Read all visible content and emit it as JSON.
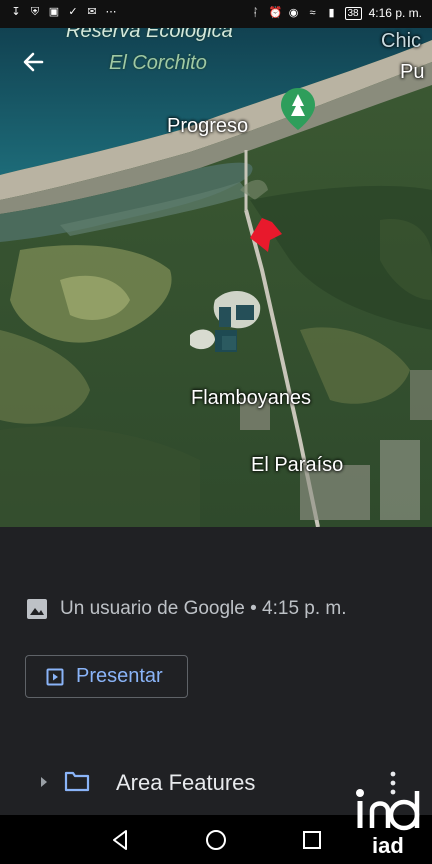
{
  "status_bar": {
    "battery": "38",
    "time": "4:16 p. m.",
    "left_icons": [
      "download-icon",
      "shield-icon",
      "image-icon",
      "check-icon",
      "mail-icon",
      "more-dots-icon"
    ],
    "right_icons": [
      "bluetooth-icon",
      "alarm-icon",
      "eye-icon",
      "wifi-icon",
      "signal-icon"
    ]
  },
  "map": {
    "labels": {
      "reserva_line1": "Reserva Ecológica",
      "reserva_line2": "El Corchito",
      "chic": "Chic",
      "pu": "Pu",
      "progreso": "Progreso",
      "flamboyanes": "Flamboyanes",
      "el_paraiso": "El Paraíso"
    },
    "pin_color": "#e8192c",
    "park_pin_color": "#2e9e5b"
  },
  "details": {
    "author_line": "Un usuario de Google • 4:15 p. m.",
    "present_label": "Presentar",
    "folder_label": "Area Features"
  },
  "watermark": {
    "text": "iad"
  },
  "colors": {
    "accent": "#8ab4f8",
    "sheet_bg": "#202124"
  }
}
